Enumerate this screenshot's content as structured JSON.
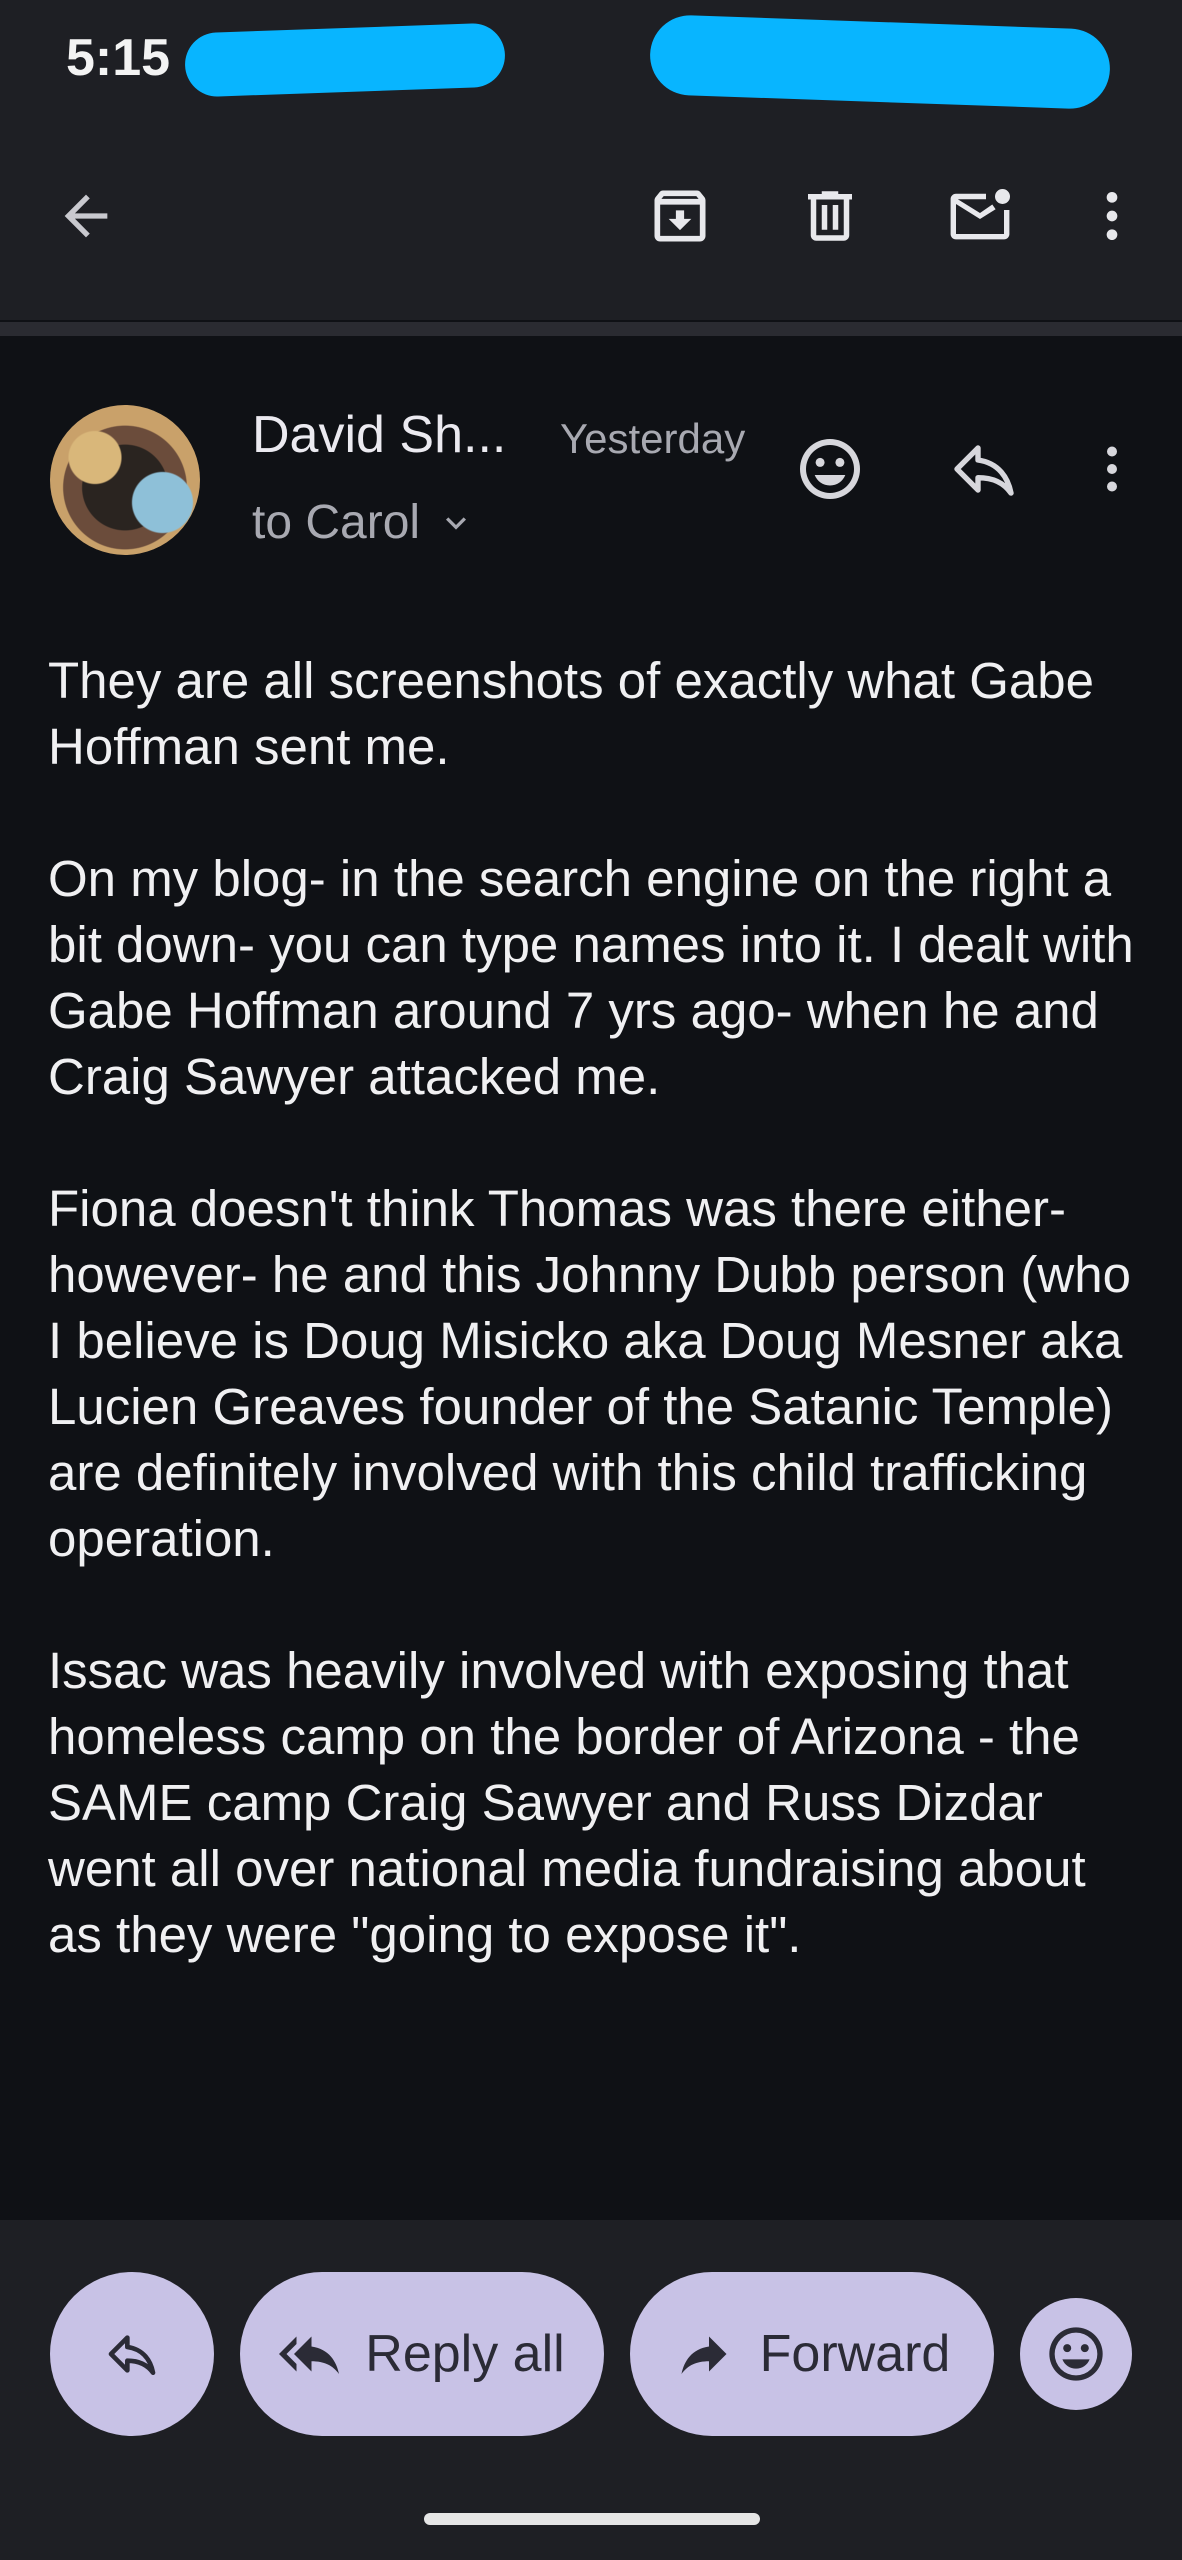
{
  "status_bar": {
    "time": "5:15"
  },
  "toolbar": {
    "back_icon": "arrow-back-icon",
    "archive_icon": "archive-icon",
    "delete_icon": "trash-icon",
    "mark_unread_icon": "mail-unread-icon",
    "more_icon": "more-vert-icon"
  },
  "message": {
    "sender_name": "David Sh...",
    "time": "Yesterday",
    "recipient_line": "to Carol",
    "paragraphs": [
      "They are all screenshots of exactly what Gabe Hoffman sent me.",
      "On my blog- in the search engine on the right a bit down- you can type names into it. I dealt with Gabe Hoffman around 7 yrs ago- when he and Craig Sawyer attacked me.",
      "Fiona doesn't think Thomas was there either- however- he and this Johnny Dubb person (who I believe is Doug Misicko aka Doug Mesner aka Lucien Greaves founder of the Satanic Temple) are definitely involved with this child trafficking operation.",
      "Issac was heavily involved with exposing that homeless camp on the border of Arizona - the SAME camp Craig Sawyer and Russ Dizdar went all over national media fundraising about as they were \"going to expose it\"."
    ]
  },
  "actions": {
    "reply_all_label": "Reply all",
    "forward_label": "Forward"
  },
  "colors": {
    "background": "#0f1115",
    "bar_background": "#1e1f24",
    "pill": "#c8c2e6",
    "redaction": "#08b5ff"
  }
}
